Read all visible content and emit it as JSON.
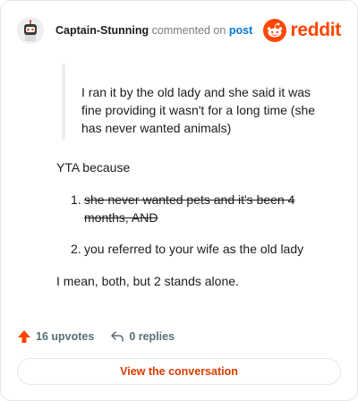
{
  "header": {
    "author": "Captain-Stunning",
    "action_text": "commented on",
    "post_link": "post",
    "brand": "reddit"
  },
  "comment": {
    "quote": "I ran it by the old lady and she said it was fine providing it wasn't for a long time (she has never wanted animals)",
    "verdict": "YTA because",
    "list": [
      {
        "num": "1.",
        "text": "she never wanted pets and it's been 4 months, AND",
        "struck": true
      },
      {
        "num": "2.",
        "text": "you referred to your wife as the old lady",
        "struck": false
      }
    ],
    "closing": "I mean, both, but 2 stands alone."
  },
  "actions": {
    "upvotes": "16 upvotes",
    "replies": "0 replies"
  },
  "cta": {
    "label": "View the conversation"
  },
  "colors": {
    "brand": "#ff4500",
    "link": "#0079d3",
    "cta": "#d93a00",
    "muted": "#576f76"
  }
}
